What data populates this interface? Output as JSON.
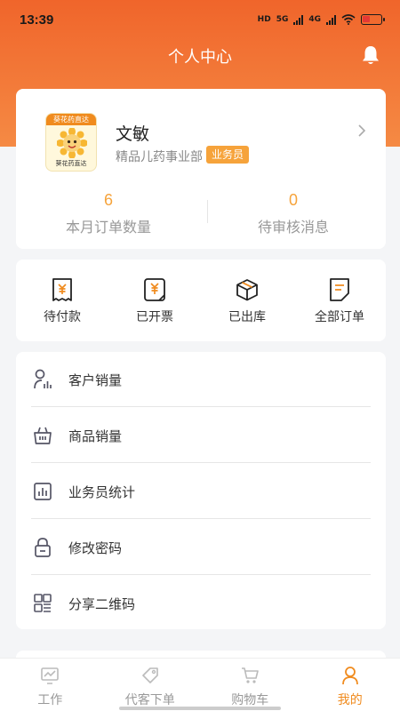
{
  "status_bar": {
    "time": "13:39",
    "network_tags": [
      "HD",
      "5G",
      "4G"
    ]
  },
  "header": {
    "title": "个人中心",
    "notification_icon": "bell-icon"
  },
  "profile": {
    "logo_top_text": "葵花药直达",
    "logo_bottom_text": "葵花药直达",
    "name": "文敏",
    "department": "精品儿药事业部",
    "role_badge": "业务员",
    "stats": [
      {
        "value": "6",
        "label": "本月订单数量"
      },
      {
        "value": "0",
        "label": "待审核消息"
      }
    ]
  },
  "orders": [
    {
      "label": "待付款",
      "icon": "receipt-yen-icon"
    },
    {
      "label": "已开票",
      "icon": "invoice-yen-icon"
    },
    {
      "label": "已出库",
      "icon": "box-icon"
    },
    {
      "label": "全部订单",
      "icon": "document-icon"
    }
  ],
  "menu": [
    {
      "label": "客户销量",
      "icon": "customer-stats-icon"
    },
    {
      "label": "商品销量",
      "icon": "basket-icon"
    },
    {
      "label": "业务员统计",
      "icon": "bar-chart-icon"
    },
    {
      "label": "修改密码",
      "icon": "lock-icon"
    },
    {
      "label": "分享二维码",
      "icon": "qr-code-icon"
    }
  ],
  "tabbar": [
    {
      "label": "工作",
      "icon": "monitor-icon",
      "active": false
    },
    {
      "label": "代客下单",
      "icon": "tag-icon",
      "active": false
    },
    {
      "label": "购物车",
      "icon": "cart-icon",
      "active": false
    },
    {
      "label": "我的",
      "icon": "user-icon",
      "active": true
    }
  ],
  "colors": {
    "brand_orange": "#f0652b",
    "accent": "#f6a33b",
    "active_tab": "#f08b1e"
  }
}
